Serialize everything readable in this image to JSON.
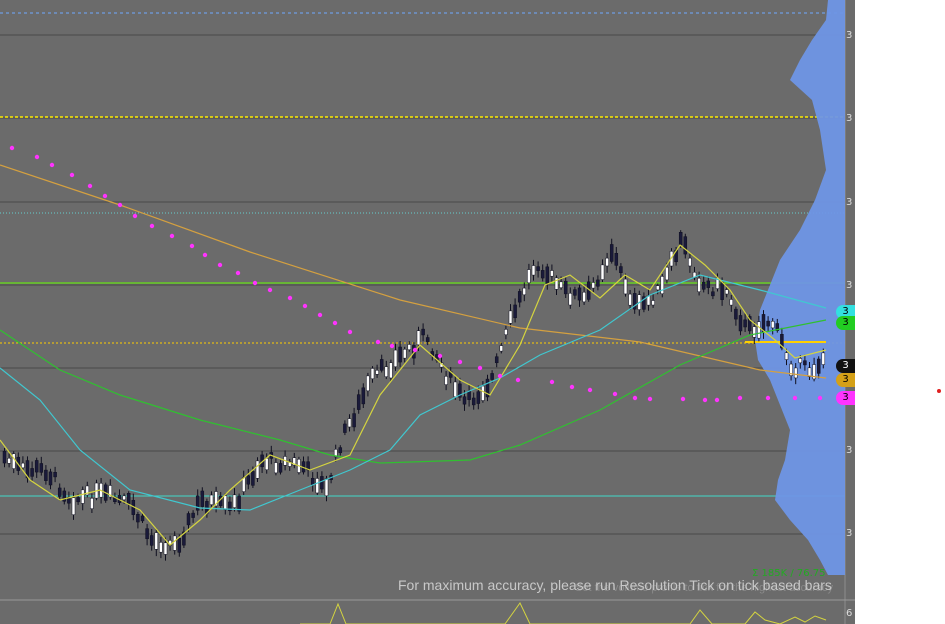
{
  "chart": {
    "message": "For maximum accuracy, please run Resolution Tick on tick based bars",
    "overlay_note": "Set the volume profile to tick for the highest accuracy",
    "volume_stats": "Σ 185K / 76.75",
    "axis_ticks": [
      "3",
      "3",
      "3",
      "3",
      "3",
      "3",
      "6"
    ],
    "price_tags": [
      {
        "label": "3",
        "color": "#33e0e0",
        "text_color": "#000000"
      },
      {
        "label": "3",
        "color": "#22cc22",
        "text_color": "#000000"
      },
      {
        "label": "3",
        "color": "#111111",
        "text_color": "#ffffff"
      },
      {
        "label": "3",
        "color": "#d4a017",
        "text_color": "#000000"
      },
      {
        "label": "3",
        "color": "#ff33ff",
        "text_color": "#000000"
      }
    ],
    "colors": {
      "background": "#6b6b6b",
      "candle_up": "#ffffff",
      "candle_down": "#1a1a3a",
      "sma_fast": "#d4d440",
      "sma_mid": "#40c8d0",
      "sma_slow": "#30c030",
      "sma_long": "#d4a040",
      "parabolic_sar": "#ff33ff",
      "volume_profile": "#6f96e6",
      "poc_line": "#ffd000"
    }
  }
}
